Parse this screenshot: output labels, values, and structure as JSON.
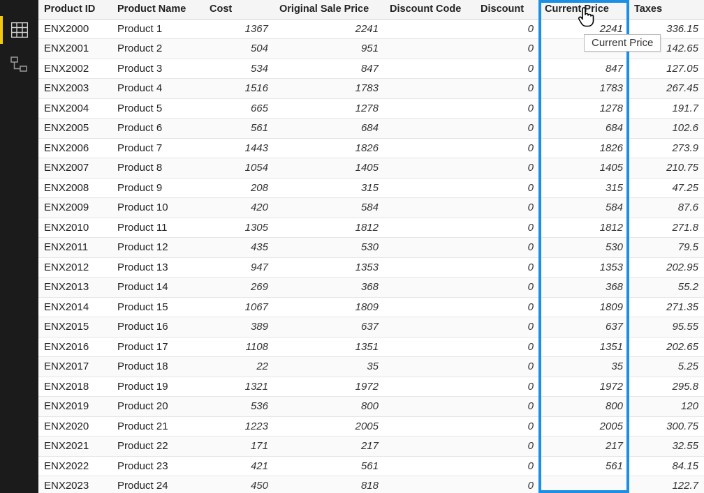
{
  "sidebar": {
    "items": [
      {
        "name": "data-view-icon",
        "active": true
      },
      {
        "name": "model-view-icon",
        "active": false
      }
    ]
  },
  "tooltip": "Current Price",
  "table": {
    "columns": [
      {
        "label": "Product ID",
        "align": "txt",
        "selected": false
      },
      {
        "label": "Product Name",
        "align": "txt",
        "selected": false
      },
      {
        "label": "Cost",
        "align": "num",
        "selected": false
      },
      {
        "label": "Original Sale Price",
        "align": "num",
        "selected": false
      },
      {
        "label": "Discount Code",
        "align": "txt",
        "selected": false
      },
      {
        "label": "Discount",
        "align": "num",
        "selected": false
      },
      {
        "label": "Current Price",
        "align": "num",
        "selected": true
      },
      {
        "label": "Taxes",
        "align": "num",
        "selected": false
      }
    ],
    "rows": [
      [
        "ENX2000",
        "Product 1",
        "1367",
        "2241",
        "",
        "0",
        "2241",
        "336.15"
      ],
      [
        "ENX2001",
        "Product 2",
        "504",
        "951",
        "",
        "0",
        "",
        "142.65"
      ],
      [
        "ENX2002",
        "Product 3",
        "534",
        "847",
        "",
        "0",
        "847",
        "127.05"
      ],
      [
        "ENX2003",
        "Product 4",
        "1516",
        "1783",
        "",
        "0",
        "1783",
        "267.45"
      ],
      [
        "ENX2004",
        "Product 5",
        "665",
        "1278",
        "",
        "0",
        "1278",
        "191.7"
      ],
      [
        "ENX2005",
        "Product 6",
        "561",
        "684",
        "",
        "0",
        "684",
        "102.6"
      ],
      [
        "ENX2006",
        "Product 7",
        "1443",
        "1826",
        "",
        "0",
        "1826",
        "273.9"
      ],
      [
        "ENX2007",
        "Product 8",
        "1054",
        "1405",
        "",
        "0",
        "1405",
        "210.75"
      ],
      [
        "ENX2008",
        "Product 9",
        "208",
        "315",
        "",
        "0",
        "315",
        "47.25"
      ],
      [
        "ENX2009",
        "Product 10",
        "420",
        "584",
        "",
        "0",
        "584",
        "87.6"
      ],
      [
        "ENX2010",
        "Product 11",
        "1305",
        "1812",
        "",
        "0",
        "1812",
        "271.8"
      ],
      [
        "ENX2011",
        "Product 12",
        "435",
        "530",
        "",
        "0",
        "530",
        "79.5"
      ],
      [
        "ENX2012",
        "Product 13",
        "947",
        "1353",
        "",
        "0",
        "1353",
        "202.95"
      ],
      [
        "ENX2013",
        "Product 14",
        "269",
        "368",
        "",
        "0",
        "368",
        "55.2"
      ],
      [
        "ENX2014",
        "Product 15",
        "1067",
        "1809",
        "",
        "0",
        "1809",
        "271.35"
      ],
      [
        "ENX2015",
        "Product 16",
        "389",
        "637",
        "",
        "0",
        "637",
        "95.55"
      ],
      [
        "ENX2016",
        "Product 17",
        "1108",
        "1351",
        "",
        "0",
        "1351",
        "202.65"
      ],
      [
        "ENX2017",
        "Product 18",
        "22",
        "35",
        "",
        "0",
        "35",
        "5.25"
      ],
      [
        "ENX2018",
        "Product 19",
        "1321",
        "1972",
        "",
        "0",
        "1972",
        "295.8"
      ],
      [
        "ENX2019",
        "Product 20",
        "536",
        "800",
        "",
        "0",
        "800",
        "120"
      ],
      [
        "ENX2020",
        "Product 21",
        "1223",
        "2005",
        "",
        "0",
        "2005",
        "300.75"
      ],
      [
        "ENX2021",
        "Product 22",
        "171",
        "217",
        "",
        "0",
        "217",
        "32.55"
      ],
      [
        "ENX2022",
        "Product 23",
        "421",
        "561",
        "",
        "0",
        "561",
        "84.15"
      ],
      [
        "ENX2023",
        "Product 24",
        "450",
        "818",
        "",
        "0",
        "",
        "122.7"
      ]
    ]
  }
}
